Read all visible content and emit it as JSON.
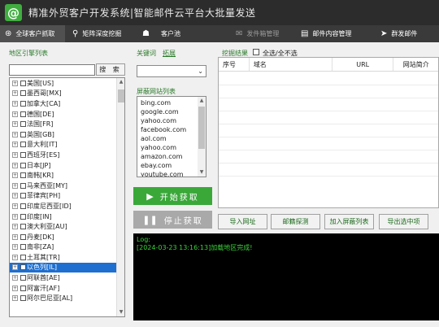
{
  "window": {
    "logo_glyph": "@",
    "title": "精准外贸客户开发系统|智能邮件云平台大批量发送"
  },
  "toolbar": {
    "items": [
      {
        "label": "全球客户抓取",
        "icon": "globe-icon",
        "glyph": "⊛"
      },
      {
        "label": "矩阵深度挖掘",
        "icon": "search-icon",
        "glyph": "⚲"
      },
      {
        "label": "客户池",
        "icon": "users-icon",
        "glyph": "☗"
      },
      {
        "label": "发件箱管理",
        "icon": "outbox-icon",
        "glyph": "✉"
      },
      {
        "label": "邮件内容管理",
        "icon": "document-icon",
        "glyph": "▤"
      },
      {
        "label": "群发邮件",
        "icon": "send-icon",
        "glyph": "➤"
      }
    ]
  },
  "region": {
    "title": "地区引擎列表",
    "search_value": "",
    "search_button": "搜 索",
    "items": [
      "美国[US]",
      "墨西哥[MX]",
      "加拿大[CA]",
      "德国[DE]",
      "法国[FR]",
      "英国[GB]",
      "意大利[IT]",
      "西班牙[ES]",
      "日本[JP]",
      "南韩[KR]",
      "马来西亚[MY]",
      "菲律宾[PH]",
      "印度尼西亚[ID]",
      "印度[IN]",
      "澳大利亚[AU]",
      "丹麦[DK]",
      "南非[ZA]",
      "土耳其[TR]",
      "以色列[IL]",
      "阿联酋[AE]",
      "阿富汗[AF]",
      "阿尔巴尼亚[AL]"
    ],
    "selected_index": 18
  },
  "keywords": {
    "title": "关键词",
    "expand_label": "拓展",
    "selected_value": ""
  },
  "blocked": {
    "title": "屏蔽网站列表",
    "items": [
      "bing.com",
      "google.com",
      "yahoo.com",
      "facebook.com",
      "aol.com",
      "yahoo.com",
      "amazon.com",
      "ebay.com",
      "youtube.com"
    ]
  },
  "actions": {
    "start_label": "开始获取",
    "stop_label": "停止获取"
  },
  "results": {
    "title": "挖掘结果",
    "select_all_label": "全选/全不选",
    "columns": [
      "序号",
      "域名",
      "URL",
      "网站简介"
    ]
  },
  "buttons": {
    "import_url": "导入网址",
    "mx_probe": "邮籍探测",
    "add_block": "加入屏蔽列表",
    "export_selected": "导出选中项"
  },
  "log": {
    "label": "Log:",
    "lines": [
      "[2024-03-23 13:16:13]加载地区完成!"
    ]
  },
  "colors": {
    "title_bg": "#2c2c2c",
    "toolbar_bg": "#3a3a3a",
    "accent_green": "#3fae3f",
    "start_button": "#39a839",
    "stop_button": "#a9a9a9",
    "selection": "#1e6fd0",
    "log_text": "#3cd23c"
  }
}
